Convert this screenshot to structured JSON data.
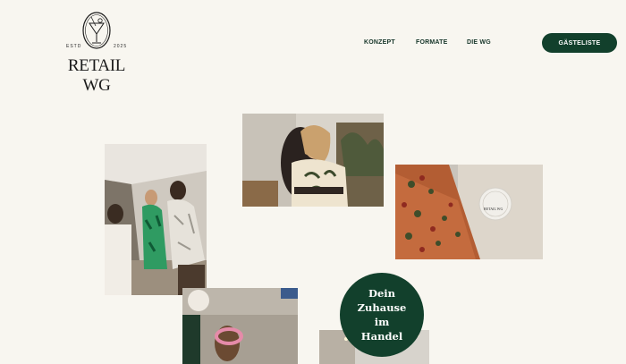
{
  "brand": {
    "name": "RETAIL WG",
    "estd_label": "ESTD",
    "year": "2025",
    "emblem_icon": "cocktail-glass-emblem-icon"
  },
  "nav": {
    "items": [
      {
        "label": "KONZEPT"
      },
      {
        "label": "FORMATE"
      },
      {
        "label": "DIE WG"
      }
    ],
    "cta_label": "GÄSTELISTE"
  },
  "hero": {
    "badge_lines": [
      "Dein",
      "Zuhause",
      "im",
      "Handel"
    ]
  },
  "photos": {
    "pizza_plate_text": "RETAIL WG"
  },
  "colors": {
    "background": "#f8f6f0",
    "brand_green": "#12402c",
    "nav_text": "#17362a"
  }
}
